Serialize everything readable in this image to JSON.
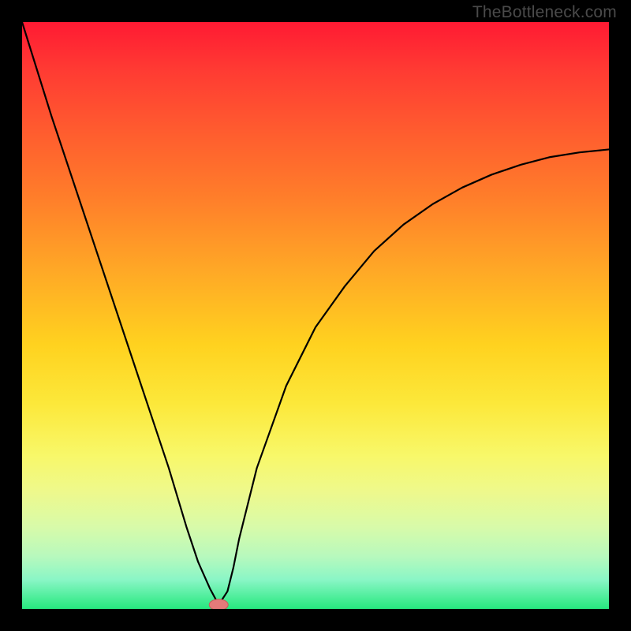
{
  "watermark": "TheBottleneck.com",
  "chart_data": {
    "type": "line",
    "title": "",
    "xlabel": "",
    "ylabel": "",
    "xlim": [
      0,
      100
    ],
    "ylim": [
      0,
      100
    ],
    "grid": false,
    "legend": false,
    "series": [
      {
        "name": "bottleneck-curve",
        "x": [
          0,
          5,
          10,
          15,
          20,
          25,
          28,
          30,
          32,
          33.5,
          35,
          36,
          37,
          40,
          45,
          50,
          55,
          60,
          65,
          70,
          75,
          80,
          85,
          90,
          95,
          100
        ],
        "y": [
          100,
          84,
          69,
          54,
          39,
          24,
          14,
          8,
          3.5,
          0.7,
          3,
          7,
          12,
          24,
          38,
          48,
          55,
          61,
          65.5,
          69,
          71.8,
          74,
          75.7,
          77,
          77.8,
          78.3
        ]
      }
    ],
    "bottleneck_marker": {
      "x": 33.5,
      "y": 0.7
    },
    "colors": {
      "curve": "#000000",
      "marker": "#e47a7a",
      "gradient_top": "#ff1a33",
      "gradient_bottom": "#26e87e",
      "frame": "#000000"
    }
  }
}
